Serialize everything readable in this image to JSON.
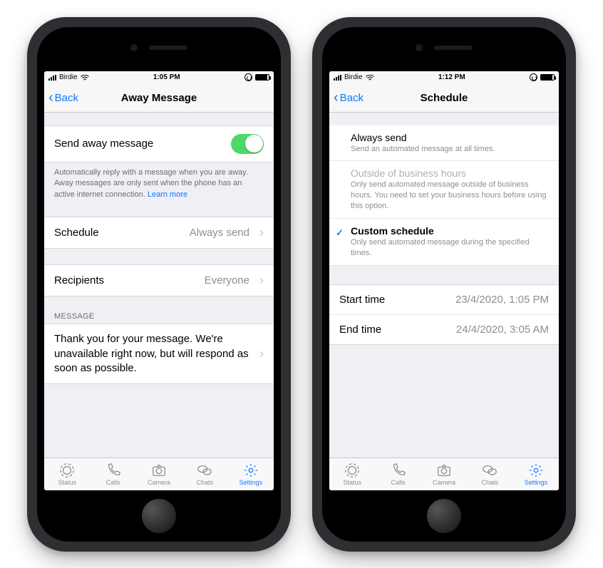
{
  "left": {
    "status": {
      "carrier": "Birdie",
      "time": "1:05 PM"
    },
    "nav": {
      "back": "Back",
      "title": "Away Message"
    },
    "toggle_label": "Send away message",
    "footer_text": "Automatically reply with a message when you are away. Away messages are only sent when the phone has an active internet connection. ",
    "learn_more": "Learn more",
    "schedule_label": "Schedule",
    "schedule_value": "Always send",
    "recipients_label": "Recipients",
    "recipients_value": "Everyone",
    "message_header": "MESSAGE",
    "message_body": "Thank you for your message. We're unavailable right now, but will respond as soon as possible."
  },
  "right": {
    "status": {
      "carrier": "Birdie",
      "time": "1:12 PM"
    },
    "nav": {
      "back": "Back",
      "title": "Schedule"
    },
    "options": {
      "always": {
        "title": "Always send",
        "desc": "Send an automated message at all times."
      },
      "outside": {
        "title": "Outside of business hours",
        "desc": "Only send automated message outside of business hours. You need to set your business hours before using this option."
      },
      "custom": {
        "title": "Custom schedule",
        "desc": "Only send automated message during the specified times."
      }
    },
    "start_label": "Start time",
    "start_value": "23/4/2020, 1:05 PM",
    "end_label": "End time",
    "end_value": "24/4/2020, 3:05 AM"
  },
  "tabs": {
    "status": "Status",
    "calls": "Calls",
    "camera": "Camera",
    "chats": "Chats",
    "settings": "Settings"
  }
}
